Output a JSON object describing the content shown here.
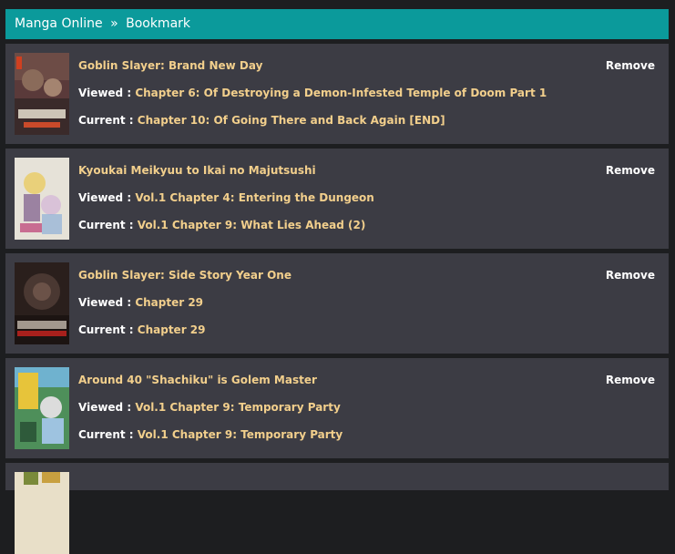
{
  "header": {
    "site": "Manga Online",
    "separator": "»",
    "page": "Bookmark"
  },
  "labels": {
    "viewed": "Viewed :",
    "current": "Current :",
    "remove": "Remove"
  },
  "bookmarks": [
    {
      "title": "Goblin Slayer: Brand New Day",
      "viewed": "Chapter 6: Of Destroying a Demon-Infested Temple of Doom Part 1",
      "current": "Chapter 10: Of Going There and Back Again [END]"
    },
    {
      "title": "Kyoukai Meikyuu to Ikai no Majutsushi",
      "viewed": "Vol.1 Chapter 4: Entering the Dungeon",
      "current": "Vol.1 Chapter 9: What Lies Ahead (2)"
    },
    {
      "title": "Goblin Slayer: Side Story Year One",
      "viewed": "Chapter 29",
      "current": "Chapter 29"
    },
    {
      "title": "Around 40 \"Shachiku\" is Golem Master",
      "viewed": "Vol.1 Chapter 9: Temporary Party",
      "current": "Vol.1 Chapter 9: Temporary Party"
    }
  ],
  "colors": {
    "header_bg": "#0b9a9b",
    "item_bg": "#3c3c44",
    "page_bg": "#1d1e20",
    "accent_text": "#f2cf8c"
  }
}
